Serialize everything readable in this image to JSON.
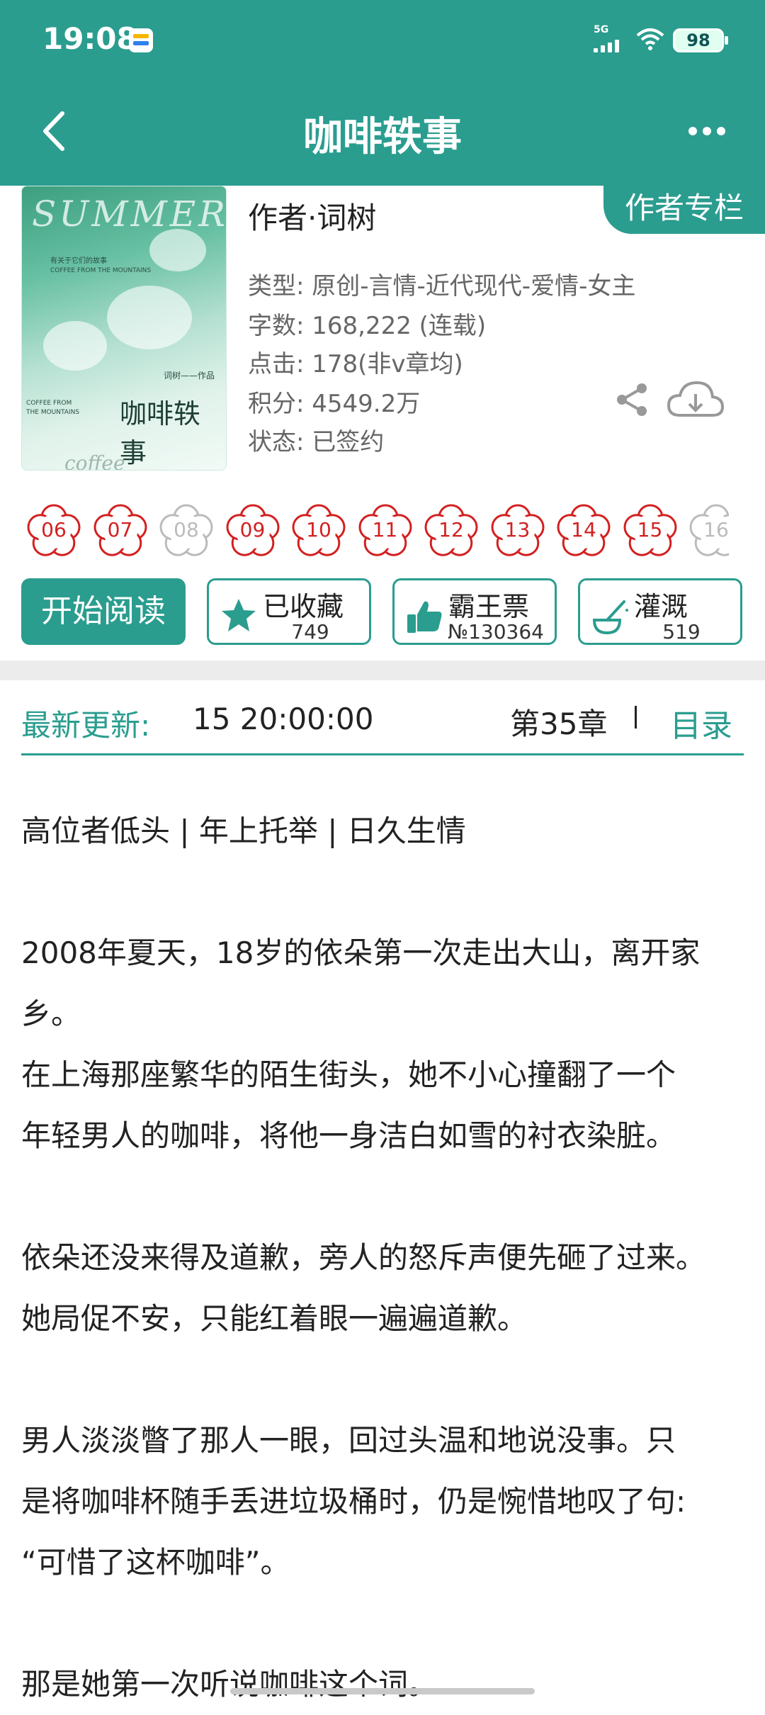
{
  "status_bar": {
    "time": "19:08",
    "network": "5G",
    "battery": "98"
  },
  "nav": {
    "title": "咖啡轶事",
    "back_icon": "chevron-left-icon",
    "more_icon": "more-dots-icon"
  },
  "book": {
    "author_column_btn": "作者专栏",
    "author_line": "作者·词树",
    "type": "类型: 原创-言情-近代现代-爱情-女主",
    "word_count": "字数: 168,222 (连载)",
    "clicks": "点击: 178(非v章均)",
    "points": "积分: 4549.2万",
    "status": "状态: 已签约",
    "cover": {
      "title_en": "SUMMER",
      "cn_title": "咖啡轶事",
      "credit": "词树——作品",
      "small_line_1": "有关于它们的故事",
      "small_line_2": "COFFEE FROM THE MOUNTAINS",
      "en_vertical": "COFFEE FROM THE MOUNTAINS",
      "footer_script": "coffee anecdotes"
    }
  },
  "badges": [
    {
      "label": "06",
      "active": true
    },
    {
      "label": "07",
      "active": true
    },
    {
      "label": "08",
      "active": false
    },
    {
      "label": "09",
      "active": true
    },
    {
      "label": "10",
      "active": true
    },
    {
      "label": "11",
      "active": true
    },
    {
      "label": "12",
      "active": true
    },
    {
      "label": "13",
      "active": true
    },
    {
      "label": "14",
      "active": true
    },
    {
      "label": "15",
      "active": true
    },
    {
      "label": "16",
      "active": false
    }
  ],
  "actions": {
    "read": "开始阅读",
    "favorite": {
      "label": "已收藏",
      "count": "749"
    },
    "vote": {
      "label": "霸王票",
      "count": "№130364"
    },
    "water": {
      "label": "灌溉",
      "count": "519"
    }
  },
  "update": {
    "label": "最新更新:",
    "time": "15 20:00:00",
    "chapter": "第35章",
    "toc": "目录"
  },
  "intro": [
    "高位者低头 | 年上托举 | 日久生情",
    "",
    "2008年夏天，18岁的依朵第一次走出大山，离开家",
    "乡。",
    "在上海那座繁华的陌生街头，她不小心撞翻了一个",
    "年轻男人的咖啡，将他一身洁白如雪的衬衣染脏。",
    "",
    "依朵还没来得及道歉，旁人的怒斥声便先砸了过来。",
    "她局促不安，只能红着眼一遍遍道歉。",
    "",
    "男人淡淡瞥了那人一眼，回过头温和地说没事。只",
    "是将咖啡杯随手丢进垃圾桶时，仍是惋惜地叹了句:",
    "“可惜了这杯咖啡”。",
    "",
    "那是她第一次听说咖啡这个词。"
  ],
  "colors": {
    "brand": "#2a9d8f",
    "badge_active": "#d32020",
    "badge_inactive": "#bbbbbb"
  }
}
